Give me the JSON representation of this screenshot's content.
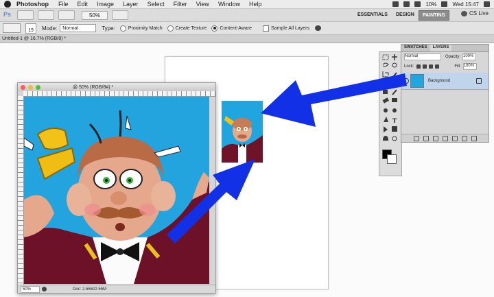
{
  "menubar": {
    "app": "Photoshop",
    "items": [
      "File",
      "Edit",
      "Image",
      "Layer",
      "Select",
      "Filter",
      "View",
      "Window",
      "Help"
    ],
    "battery": "10%",
    "clock": "Wed 15:47"
  },
  "appbar": {
    "zoom": "50%",
    "workspaces": [
      "ESSENTIALS",
      "DESIGN",
      "PAINTING"
    ],
    "cs_live": "CS Live"
  },
  "options": {
    "brush_size": "19",
    "mode_label": "Mode:",
    "mode_value": "Normal",
    "type_label": "Type:",
    "type_options": [
      "Proximity Match",
      "Create Texture",
      "Content-Aware"
    ],
    "sample_all": "Sample All Layers"
  },
  "document": {
    "tab_label": "Untitled-1 @ 16.7% (RGB/8) *",
    "float_title": "@ 50% (RGB/8#) *",
    "status_zoom": "50%",
    "status_doc": "Doc: 2.55M/2.55M"
  },
  "layers_panel": {
    "tabs": [
      "SWATCHES",
      "LAYERS"
    ],
    "blend_mode": "Normal",
    "opacity_label": "Opacity:",
    "opacity_value": "100%",
    "lock_label": "Lock:",
    "fill_label": "Fill:",
    "fill_value": "100%",
    "layer_name": "Background"
  },
  "colors": {
    "arrow": "#1230e6",
    "art_background": "#23a4de"
  }
}
